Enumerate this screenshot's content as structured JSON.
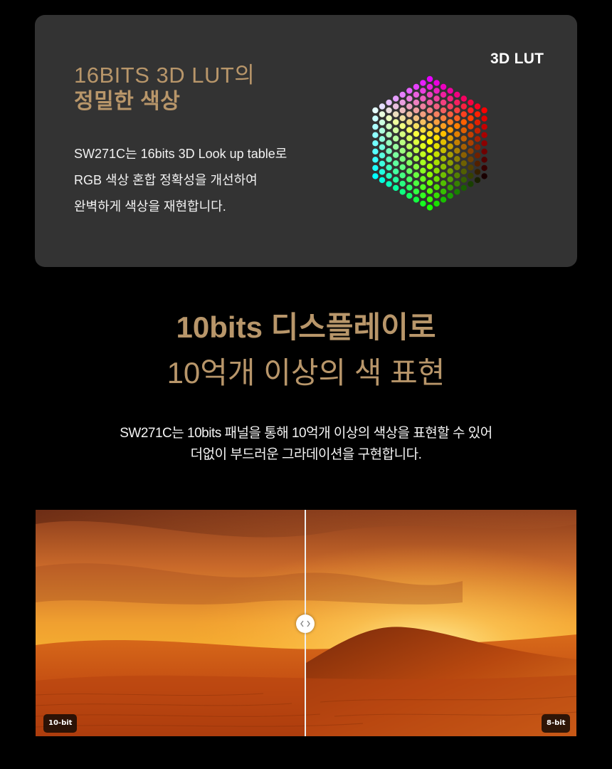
{
  "lut_section": {
    "title_line1": "16BITS 3D LUT의",
    "title_line2": "정밀한 색상",
    "description": [
      "SW271C는 16bits 3D Look up table로",
      "RGB 색상 혼합 정확성을 개선하여",
      "완벽하게 색상을 재현합니다."
    ],
    "badge": "3D LUT",
    "cube_icon": "rgb-color-cube-illustration"
  },
  "display_section": {
    "title_bold": "10bits 디스플레이",
    "title_regular_suffix": "로",
    "title_line2": "10억개 이상의 색 표현",
    "description": [
      "SW271C는 10bits 패널을 통해 10억개 이상의 색상을 표현할 수 있어",
      "더없이 부드러운 그라데이션을 구현합니다."
    ]
  },
  "comparison": {
    "left_label": "10-bit",
    "right_label": "8-bit",
    "handle_icon": "left-right-chevrons-icon",
    "image": "desert-sunset-photo"
  },
  "colors": {
    "accent_gold": "#b8966a",
    "card_bg": "#333333",
    "page_bg": "#000000"
  }
}
